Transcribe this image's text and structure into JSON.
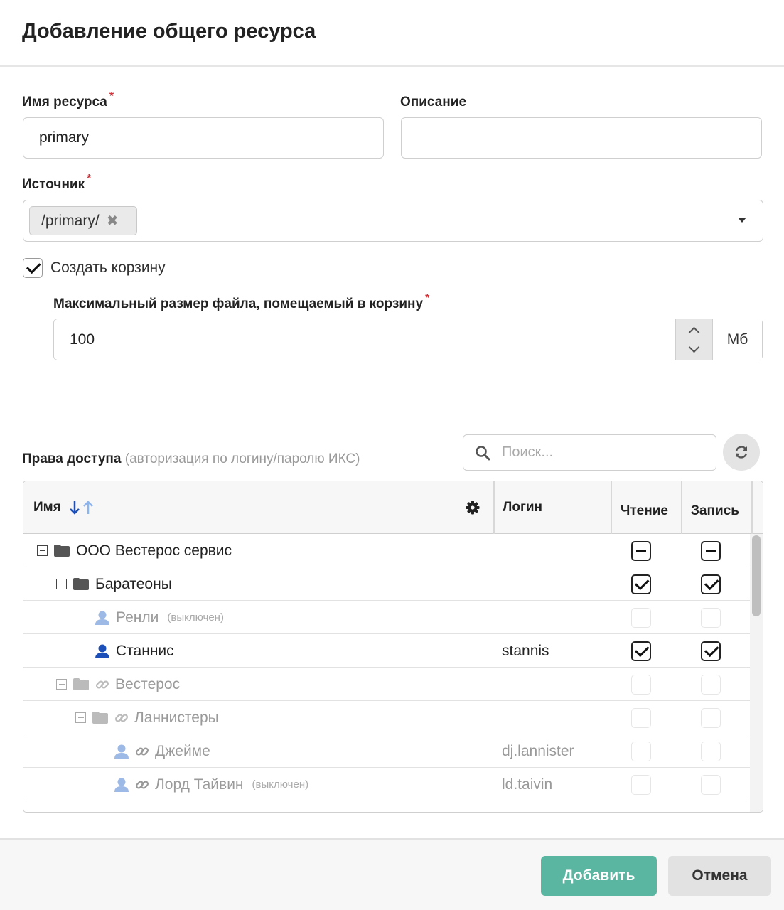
{
  "dialog": {
    "title": "Добавление общего ресурса"
  },
  "form": {
    "resource_name_label": "Имя ресурса",
    "resource_name_value": "primary",
    "description_label": "Описание",
    "description_value": "",
    "source_label": "Источник",
    "source_tag": "/primary/",
    "create_bin_label": "Создать корзину",
    "create_bin_checked": true,
    "max_size_label": "Максимальный размер файла, помещаемый в корзину",
    "max_size_value": "100",
    "max_size_unit": "Мб",
    "required_mark": "*"
  },
  "access": {
    "label": "Права доступа",
    "hint": "(авторизация по логину/паролю ИКС)",
    "search_placeholder": "Поиск..."
  },
  "table": {
    "columns": {
      "name": "Имя",
      "login": "Логин",
      "read": "Чтение",
      "write": "Запись"
    },
    "rows": [
      {
        "name": "ООО Вестерос сервис",
        "note": "",
        "login": "",
        "read": "mixed",
        "write": "mixed"
      },
      {
        "name": "Баратеоны",
        "note": "",
        "login": "",
        "read": "checked",
        "write": "checked"
      },
      {
        "name": "Ренли",
        "note": "(выключен)",
        "login": "",
        "read": "disabled",
        "write": "disabled"
      },
      {
        "name": "Станнис",
        "note": "",
        "login": "stannis",
        "read": "checked",
        "write": "checked"
      },
      {
        "name": "Вестерос",
        "note": "",
        "login": "",
        "read": "disabled",
        "write": "disabled"
      },
      {
        "name": "Ланнистеры",
        "note": "",
        "login": "",
        "read": "disabled",
        "write": "disabled"
      },
      {
        "name": "Джейме",
        "note": "",
        "login": "dj.lannister",
        "read": "disabled",
        "write": "disabled"
      },
      {
        "name": "Лорд Тайвин",
        "note": "(выключен)",
        "login": "ld.taivin",
        "read": "disabled",
        "write": "disabled"
      }
    ]
  },
  "footer": {
    "add_label": "Добавить",
    "cancel_label": "Отмена"
  },
  "colors": {
    "primary_button": "#5ab5a1",
    "user_icon_active": "#1d4fb8",
    "user_icon_disabled": "#9db9e6",
    "folder": "#555555",
    "required": "#d0343a"
  }
}
